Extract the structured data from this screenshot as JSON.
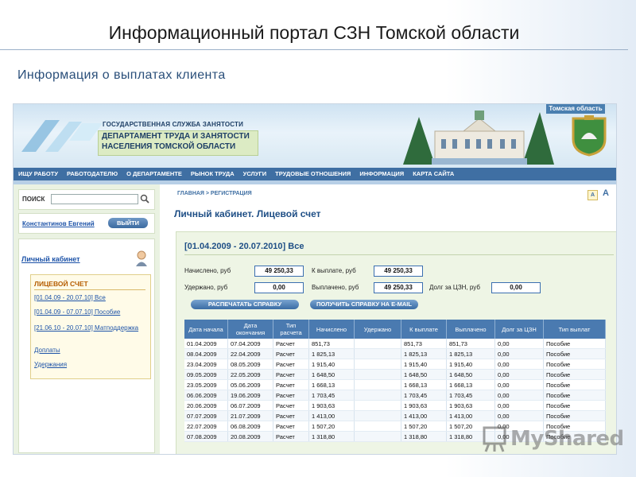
{
  "slide": {
    "title": "Информационный портал СЗН Томской области",
    "subtitle": "Информация о выплатах клиента"
  },
  "banner": {
    "region": "Томская область",
    "service": "ГОСУДАРСТВЕННАЯ СЛУЖБА ЗАНЯТОСТИ",
    "dept_line1": "ДЕПАРТАМЕНТ ТРУДА И ЗАНЯТОСТИ",
    "dept_line2": "НАСЕЛЕНИЯ ТОМСКОЙ ОБЛАСТИ"
  },
  "nav": {
    "items": [
      "ИЩУ РАБОТУ",
      "РАБОТОДАТЕЛЮ",
      "О ДЕПАРТАМЕНТЕ",
      "РЫНОК ТРУДА",
      "УСЛУГИ",
      "ТРУДОВЫЕ ОТНОШЕНИЯ",
      "ИНФОРМАЦИЯ",
      "КАРТА САЙТА"
    ]
  },
  "sidebar": {
    "search_label": "ПОИСК",
    "search_value": "",
    "user_name": "Константинов Евгений",
    "logout_label": "ВЫЙТИ",
    "cabinet_label": "Личный кабинет",
    "account_title": "ЛИЦЕВОЙ СЧЕТ",
    "links": [
      "[01.04.09 - 20.07.10] Все",
      "[01.04.09 - 07.07.10] Пособие",
      "[21.06.10 - 20.07.10] Матподдержка",
      "Доплаты",
      "Удержания"
    ]
  },
  "main": {
    "breadcrumb": "ГЛАВНАЯ > РЕГИСТРАЦИЯ",
    "font_small": "A",
    "font_large": "A",
    "heading": "Личный кабинет. Лицевой счет",
    "period": "[01.04.2009 - 20.07.2010] Все",
    "fields": {
      "accrued_label": "Начислено, руб",
      "accrued_value": "49 250,33",
      "to_pay_label": "К выплате, руб",
      "to_pay_value": "49 250,33",
      "withheld_label": "Удержано, руб",
      "withheld_value": "0,00",
      "paid_label": "Выплачено, руб",
      "paid_value": "49 250,33",
      "debt_label": "Долг за ЦЗН, руб",
      "debt_value": "0,00"
    },
    "print_button": "РАСПЕЧАТАТЬ СПРАВКУ",
    "email_button": "ПОЛУЧИТЬ СПРАВКУ НА E-MAIL",
    "table": {
      "headers": [
        "Дата начала",
        "Дата окончания",
        "Тип расчета",
        "Начислено",
        "Удержано",
        "К выплате",
        "Выплачено",
        "Долг за ЦЗН",
        "Тип выплат"
      ],
      "rows": [
        [
          "01.04.2009",
          "07.04.2009",
          "Расчет",
          "851,73",
          "",
          "851,73",
          "851,73",
          "0,00",
          "Пособие"
        ],
        [
          "08.04.2009",
          "22.04.2009",
          "Расчет",
          "1 825,13",
          "",
          "1 825,13",
          "1 825,13",
          "0,00",
          "Пособие"
        ],
        [
          "23.04.2009",
          "08.05.2009",
          "Расчет",
          "1 915,40",
          "",
          "1 915,40",
          "1 915,40",
          "0,00",
          "Пособие"
        ],
        [
          "09.05.2009",
          "22.05.2009",
          "Расчет",
          "1 648,50",
          "",
          "1 648,50",
          "1 648,50",
          "0,00",
          "Пособие"
        ],
        [
          "23.05.2009",
          "05.06.2009",
          "Расчет",
          "1 668,13",
          "",
          "1 668,13",
          "1 668,13",
          "0,00",
          "Пособие"
        ],
        [
          "06.06.2009",
          "19.06.2009",
          "Расчет",
          "1 703,45",
          "",
          "1 703,45",
          "1 703,45",
          "0,00",
          "Пособие"
        ],
        [
          "20.06.2009",
          "06.07.2009",
          "Расчет",
          "1 903,63",
          "",
          "1 903,63",
          "1 903,63",
          "0,00",
          "Пособие"
        ],
        [
          "07.07.2009",
          "21.07.2009",
          "Расчет",
          "1 413,00",
          "",
          "1 413,00",
          "1 413,00",
          "0,00",
          "Пособие"
        ],
        [
          "22.07.2009",
          "06.08.2009",
          "Расчет",
          "1 507,20",
          "",
          "1 507,20",
          "1 507,20",
          "0,00",
          "Пособие"
        ],
        [
          "07.08.2009",
          "20.08.2009",
          "Расчет",
          "1 318,80",
          "",
          "1 318,80",
          "1 318,80",
          "0,00",
          "Пособие"
        ]
      ]
    }
  },
  "watermark": "MyShared",
  "colors": {
    "nav_bg": "#3f6fa3",
    "panel_bg": "#eef5e5",
    "table_header": "#4a7ab0",
    "link": "#1d53a8"
  }
}
